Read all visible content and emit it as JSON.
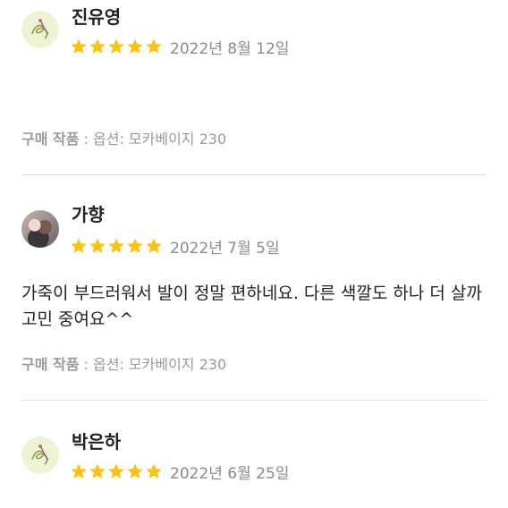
{
  "reviews": [
    {
      "author": "진유영",
      "avatar": "brand-logo-avatar",
      "rating": 5,
      "date": "2022년 8월 12일",
      "text": "",
      "option_label": "구매 작품",
      "option_sep": " : ",
      "option_value": "옵션: 모카베이지 230"
    },
    {
      "author": "가향",
      "avatar": "profile-photo-avatar",
      "rating": 5,
      "date": "2022년 7월 5일",
      "text": "가죽이 부드러워서 발이 정말 편하네요. 다른 색깔도 하나 더 살까 고민 중여요^^",
      "option_label": "구매 작품",
      "option_sep": " : ",
      "option_value": "옵션: 모카베이지 230"
    },
    {
      "author": "박은하",
      "avatar": "brand-logo-avatar",
      "rating": 5,
      "date": "2022년 6월 25일"
    }
  ],
  "colors": {
    "star": "#f7c31a",
    "date": "#8a8a8a",
    "option": "#9a9a9a",
    "divider": "#e3e3e3"
  },
  "icons": {
    "star": "star-icon",
    "logo": "brand-logo-icon"
  }
}
